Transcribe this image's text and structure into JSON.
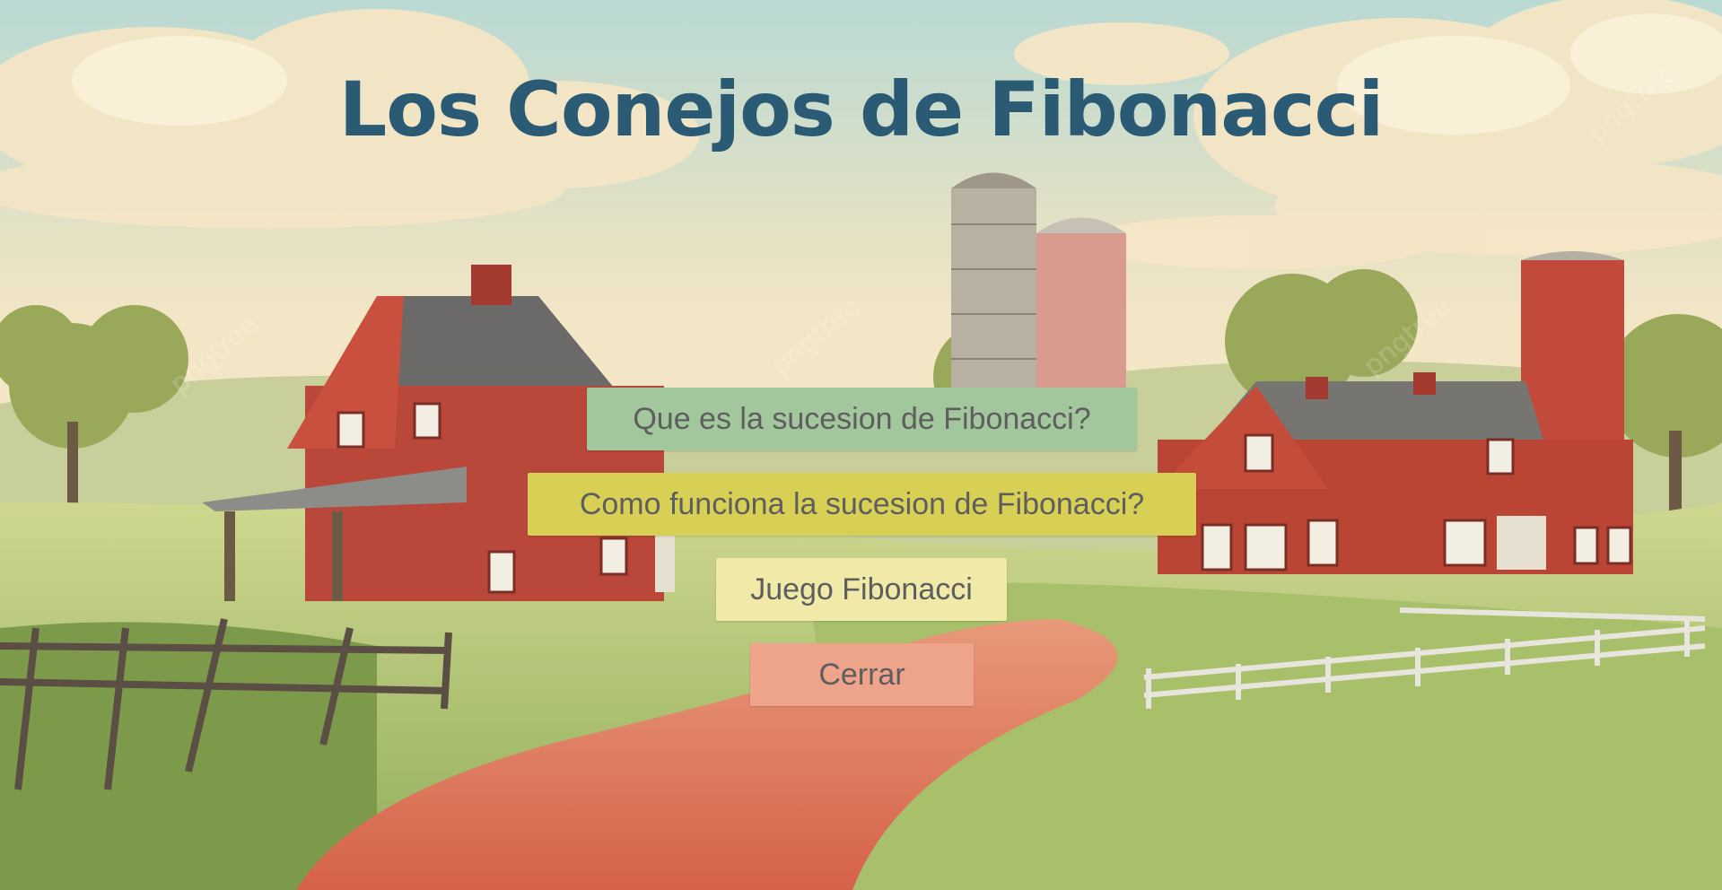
{
  "page": {
    "title": "Los Conejos de Fibonacci"
  },
  "menu": {
    "buttons": [
      {
        "label": "Que es la sucesion de Fibonacci?",
        "color": "#a3c79d"
      },
      {
        "label": "Como funciona la sucesion de Fibonacci?",
        "color": "#d8cf55"
      },
      {
        "label": "Juego Fibonacci",
        "color": "#f1e9a7"
      },
      {
        "label": "Cerrar",
        "color": "#eda48b"
      }
    ]
  },
  "theme": {
    "title_color": "#2b5b74",
    "button_text_color": "#5e5e5e"
  },
  "background": {
    "description_icon": "farm-landscape-illustration",
    "watermark": "pngtree"
  }
}
